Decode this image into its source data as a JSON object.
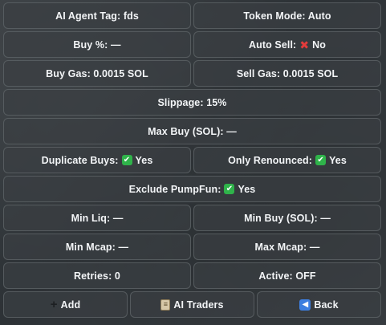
{
  "rows": {
    "r1": {
      "left": "AI Agent Tag: fds",
      "right": "Token Mode: Auto"
    },
    "r2": {
      "left": "Buy %: —",
      "right_prefix": "Auto Sell:",
      "right_value": "No"
    },
    "r3": {
      "left": "Buy Gas: 0.0015 SOL",
      "right": "Sell Gas: 0.0015 SOL"
    },
    "r4": {
      "full": "Slippage: 15%"
    },
    "r5": {
      "full": "Max Buy (SOL): —"
    },
    "r6": {
      "left_prefix": "Duplicate Buys:",
      "left_value": "Yes",
      "right_prefix": "Only Renounced:",
      "right_value": "Yes"
    },
    "r7": {
      "prefix": "Exclude PumpFun:",
      "value": "Yes"
    },
    "r8": {
      "left": "Min Liq: —",
      "right": "Min Buy (SOL): —"
    },
    "r9": {
      "left": "Min Mcap: —",
      "right": "Max Mcap: —"
    },
    "r10": {
      "left": "Retries: 0",
      "right": "Active: OFF"
    }
  },
  "footer": {
    "add_label": "Add",
    "traders_label": "AI Traders",
    "back_label": "Back"
  },
  "icons": {
    "no": "cross-mark",
    "yes": "check-mark-button",
    "add": "plus",
    "traders": "clipboard",
    "back": "back-arrow"
  }
}
